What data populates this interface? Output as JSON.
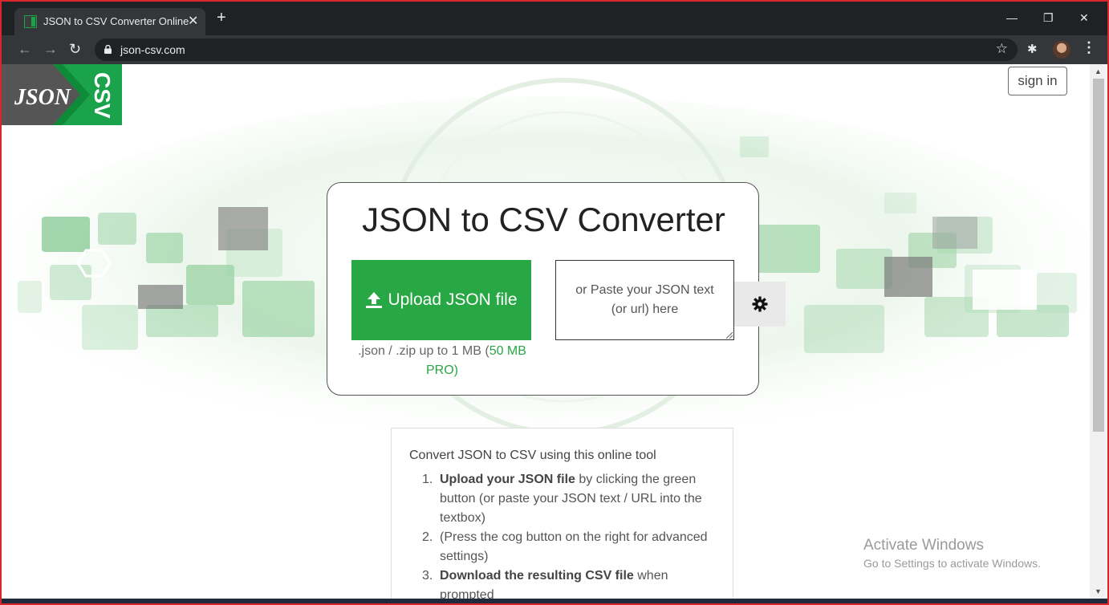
{
  "browser": {
    "tab_title": "JSON to CSV Converter Online",
    "tab_close": "✕",
    "new_tab": "+",
    "url": "json-csv.com",
    "controls": {
      "minimize": "—",
      "restore": "❐",
      "close": "✕"
    },
    "nav": {
      "back": "←",
      "forward": "→",
      "reload": "↻",
      "star": "☆",
      "extensions": "✱",
      "menu": "⋮"
    }
  },
  "header": {
    "logo_left": "JSON",
    "logo_right": "CSV",
    "sign_in_label": "sign in"
  },
  "converter": {
    "title": "JSON to CSV Converter",
    "upload_label": "Upload JSON file",
    "paste_placeholder": "or Paste your JSON text (or url) here",
    "size_note": ".json / .zip up to 1 MB (",
    "size_note_pro": "50 MB PRO)"
  },
  "instructions": {
    "heading": "Convert JSON to CSV using this online tool",
    "steps": [
      {
        "num": "1.",
        "bold": "Upload your JSON file",
        "rest": " by clicking the green button (or paste your JSON text / URL into the textbox)"
      },
      {
        "num": "2.",
        "bold": "",
        "rest": "(Press the cog button on the right for advanced settings)"
      },
      {
        "num": "3.",
        "bold": "Download the resulting CSV file",
        "rest": " when prompted"
      }
    ]
  },
  "watermark": {
    "title": "Activate Windows",
    "subtitle": "Go to Settings to activate Windows."
  },
  "colors": {
    "accent_green": "#28a745",
    "logo_green": "#1aa34a",
    "logo_gray": "#555555",
    "browser_dark": "#202124"
  }
}
